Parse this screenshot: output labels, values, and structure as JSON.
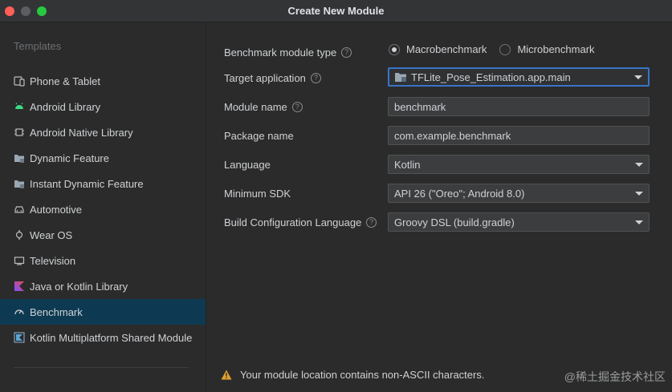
{
  "window": {
    "title": "Create New Module"
  },
  "sidebar": {
    "header": "Templates",
    "items": [
      {
        "label": "Phone & Tablet",
        "icon": "phone-tablet-icon"
      },
      {
        "label": "Android Library",
        "icon": "android-icon"
      },
      {
        "label": "Android Native Library",
        "icon": "chip-icon"
      },
      {
        "label": "Dynamic Feature",
        "icon": "folder-icon"
      },
      {
        "label": "Instant Dynamic Feature",
        "icon": "folder-icon"
      },
      {
        "label": "Automotive",
        "icon": "car-icon"
      },
      {
        "label": "Wear OS",
        "icon": "watch-icon"
      },
      {
        "label": "Television",
        "icon": "tv-icon"
      },
      {
        "label": "Java or Kotlin Library",
        "icon": "kotlin-icon"
      },
      {
        "label": "Benchmark",
        "icon": "gauge-icon",
        "selected": true
      },
      {
        "label": "Kotlin Multiplatform Shared Module",
        "icon": "kotlin-mpp-icon"
      }
    ]
  },
  "form": {
    "benchmark_type": {
      "label": "Benchmark module type",
      "options": [
        "Macrobenchmark",
        "Microbenchmark"
      ],
      "selected": "Macrobenchmark"
    },
    "target_app": {
      "label": "Target application",
      "value": "TFLite_Pose_Estimation.app.main"
    },
    "module_name": {
      "label": "Module name",
      "value": "benchmark"
    },
    "package_name": {
      "label": "Package name",
      "value": "com.example.benchmark"
    },
    "language": {
      "label": "Language",
      "value": "Kotlin"
    },
    "min_sdk": {
      "label": "Minimum SDK",
      "value": "API 26 (\"Oreo\"; Android 8.0)"
    },
    "build_config": {
      "label": "Build Configuration Language",
      "value": "Groovy DSL (build.gradle)"
    }
  },
  "warning": {
    "text": "Your module location contains non-ASCII characters."
  },
  "watermark": "@稀土掘金技术社区",
  "colors": {
    "accent": "#3874c8",
    "selected": "#0d3a52",
    "warning": "#e0a030",
    "android": "#3ddc84"
  }
}
